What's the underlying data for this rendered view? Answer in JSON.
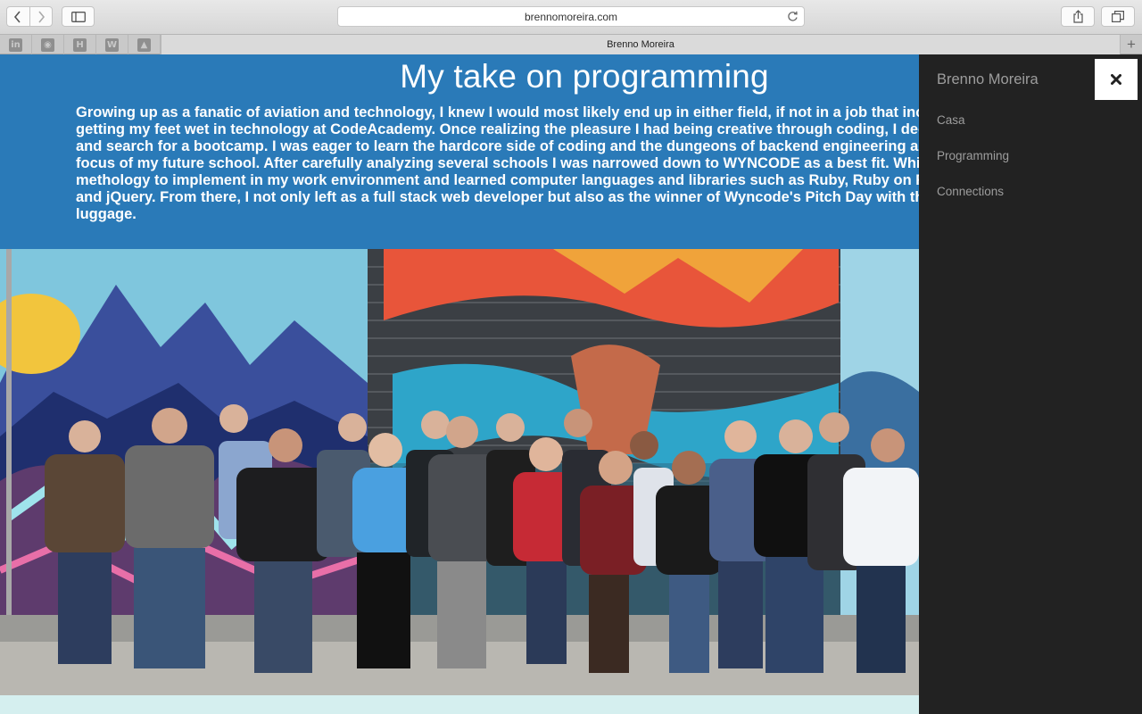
{
  "browser": {
    "url": "brennomoreira.com",
    "tab_title": "Brenno Moreira",
    "new_tab_symbol": "+",
    "favorites": [
      {
        "name": "linkedin-icon",
        "glyph": "in"
      },
      {
        "name": "github-icon",
        "glyph": "◉"
      },
      {
        "name": "hackerrank-icon",
        "glyph": "H"
      },
      {
        "name": "wordpress-icon",
        "glyph": "W"
      },
      {
        "name": "google-drive-icon",
        "glyph": "▲"
      }
    ]
  },
  "hero": {
    "title": "My take on programming",
    "paragraph_lines": [
      "Growing up as a fanatic of aviation and technology, I knew I would most likely end up in either field, if not in a job that includes",
      "getting my feet wet in technology at CodeAcademy. Once realizing the pleasure I had being creative through coding, I decided t",
      "and search for a bootcamp. I was eager to learn the hardcore side of coding and the dungeons of backend engineering and natu",
      "focus of my future school. After carefully analyzing several schools I was narrowed down to WYNCODE as a best fit. While in ther",
      "methology to implement in my work environment and learned computer languages and libraries such as Ruby, Ruby on Rails, I",
      "and jQuery. From there, I not only left as a full stack web developer but also as the winner of Wyncode's Pitch Day with the best",
      "luggage."
    ],
    "background_color": "#2a7ab8"
  },
  "photo": {
    "subject": "group-photo-in-front-of-graffiti-wall"
  },
  "sidenav": {
    "brand": "Brenno Moreira",
    "close_icon": "close-icon",
    "items": [
      {
        "label": "Casa"
      },
      {
        "label": "Programming"
      },
      {
        "label": "Connections"
      }
    ],
    "background_color": "#222222"
  }
}
